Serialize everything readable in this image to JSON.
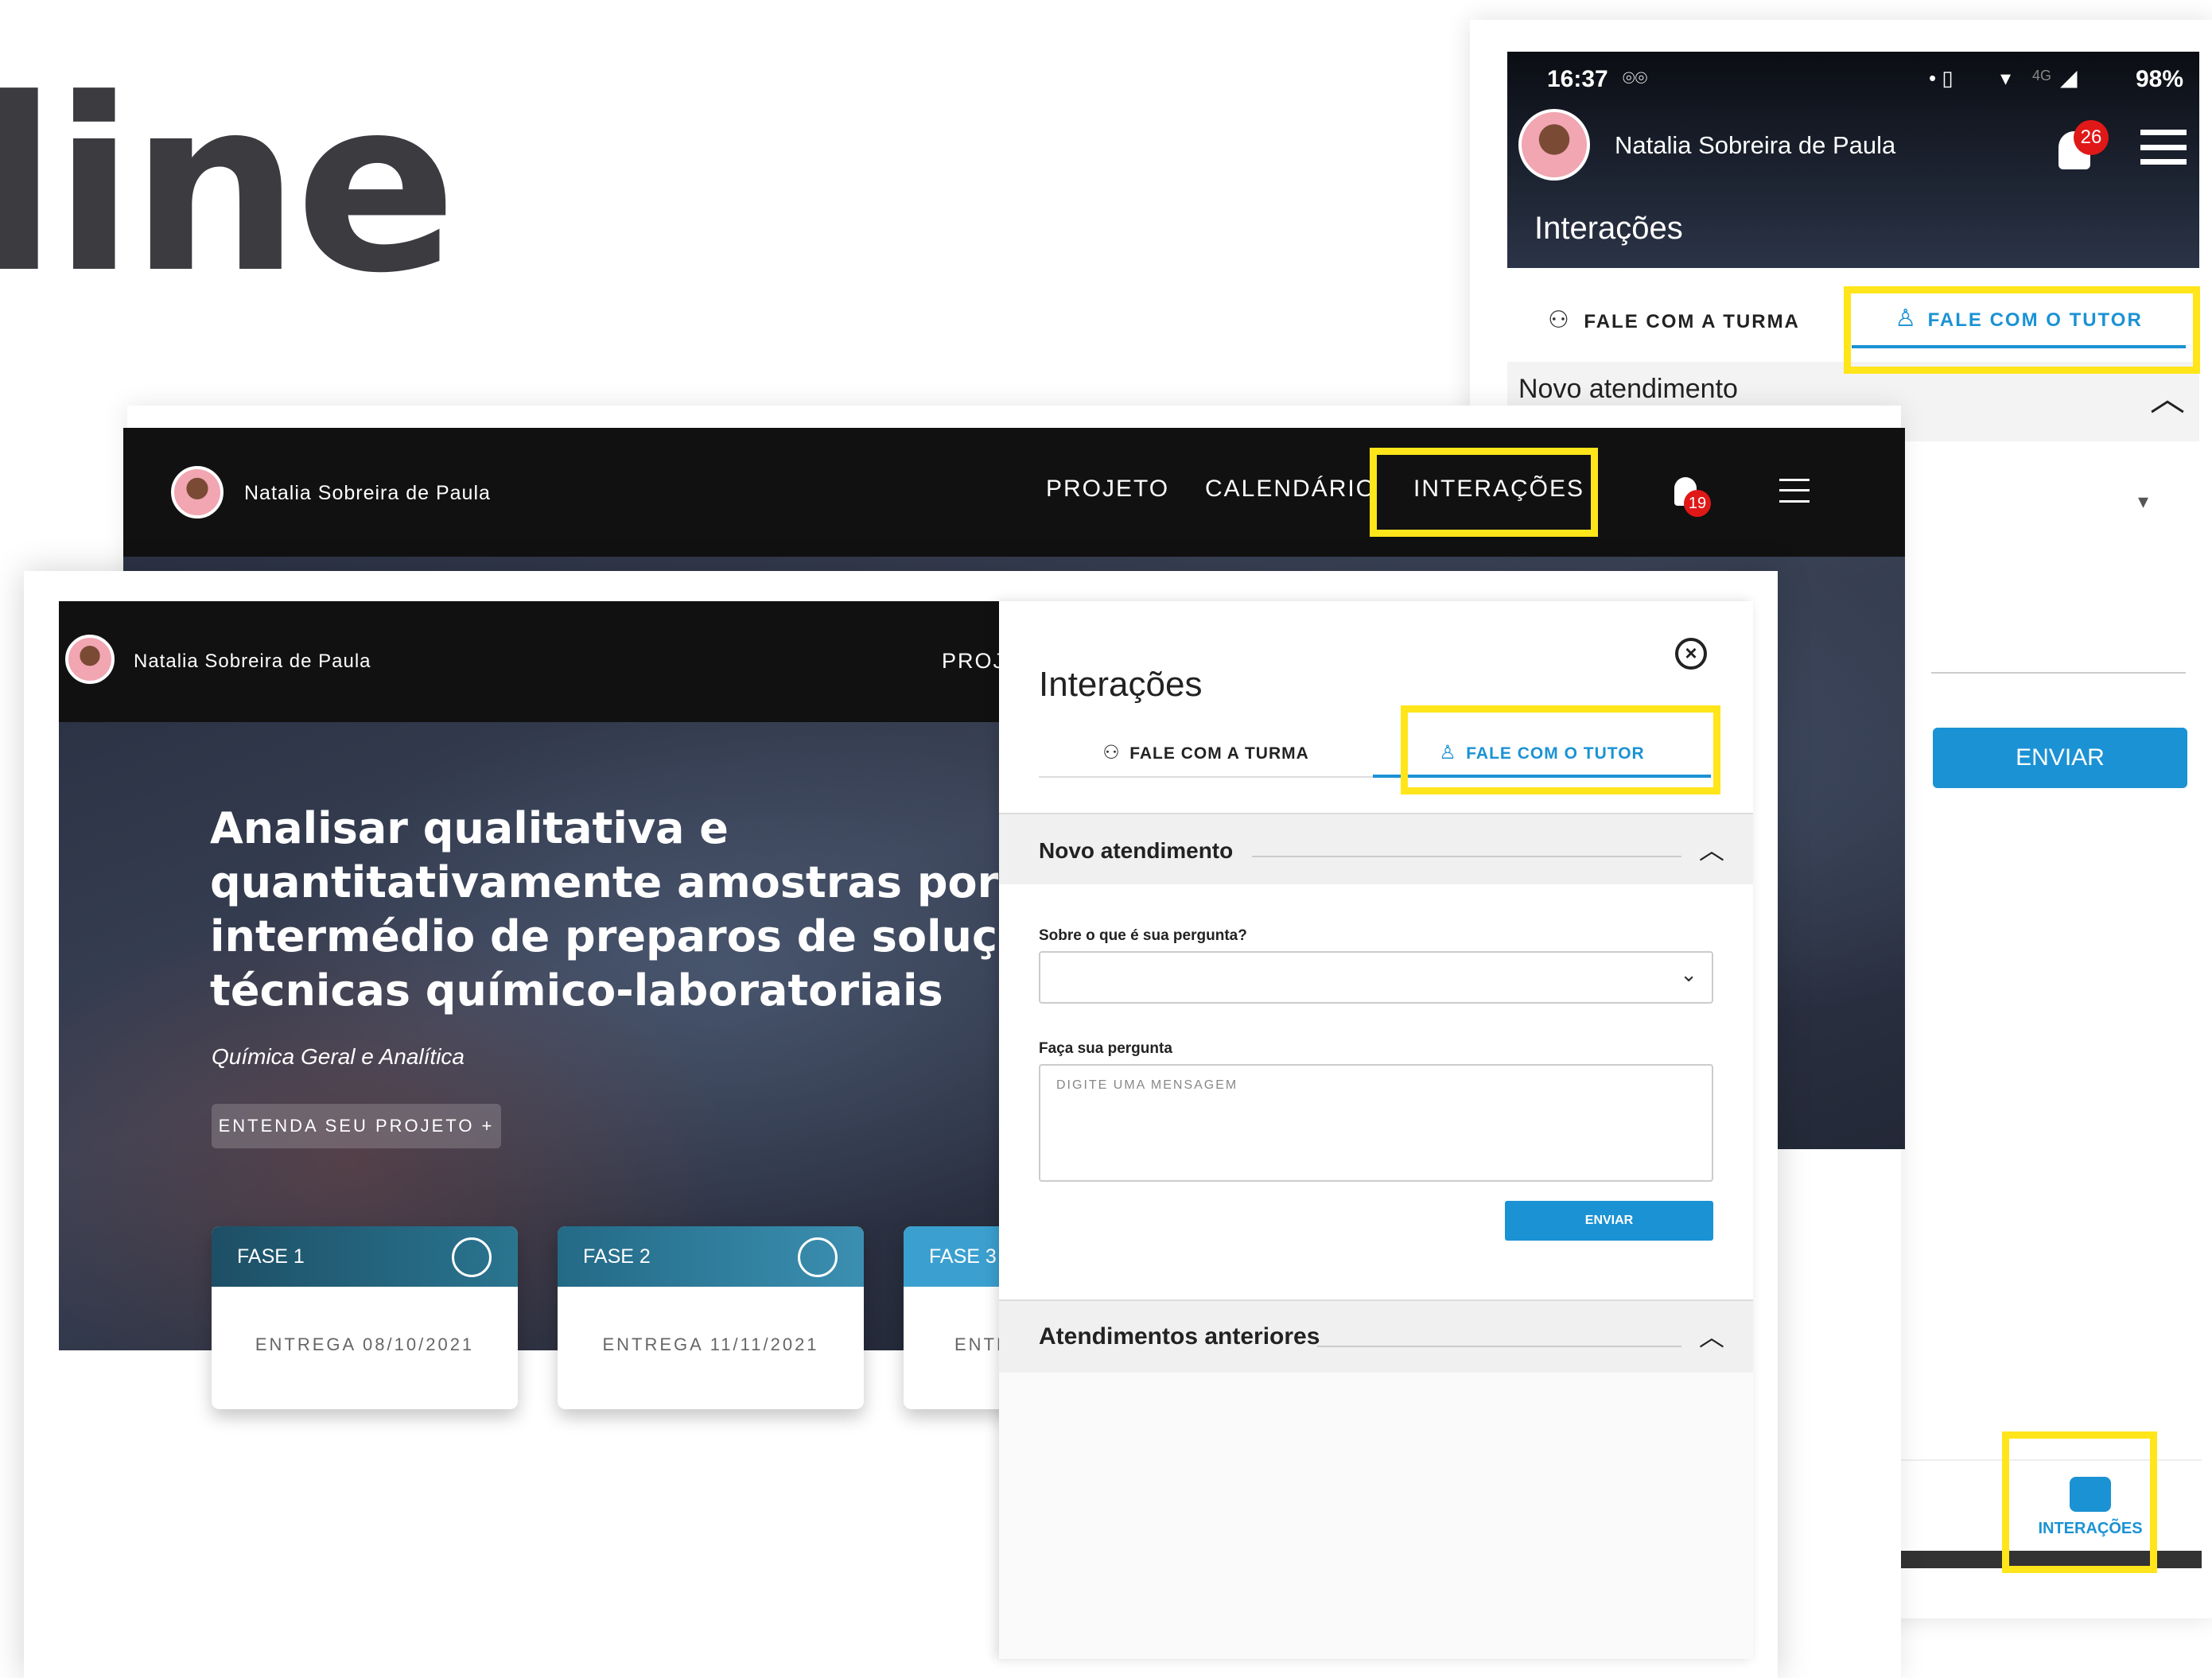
{
  "hero_word": "line",
  "user_name": "Natalia Sobreira de Paula",
  "mobile": {
    "time": "16:37",
    "battery": "98%",
    "network": "4G",
    "notif_count": "26",
    "title": "Interações",
    "tab_turma": "FALE COM A TURMA",
    "tab_tutor": "FALE COM O TUTOR",
    "novo": "Novo atendimento",
    "send": "ENVIAR",
    "bottom_nav_label": "INTERAÇÕES"
  },
  "desktop": {
    "nav": [
      "PROJETO",
      "CALENDÁRIO",
      "INTERAÇÕES"
    ],
    "notif_count": "19"
  },
  "front": {
    "nav_partial": "PROJ",
    "title_lines": [
      "Analisar qualitativa e",
      "quantitativamente amostras por",
      "intermédio de preparos de soluções",
      "técnicas químico-laboratoriais"
    ],
    "subtitle": "Química Geral e Analítica",
    "cta": "ENTENDA SEU PROJETO +",
    "phases": [
      {
        "name": "FASE 1",
        "date": "ENTREGA 08/10/2021"
      },
      {
        "name": "FASE 2",
        "date": "ENTREGA 11/11/2021"
      },
      {
        "name": "FASE 3",
        "date": "ENTR"
      }
    ],
    "panel": {
      "title": "Interações",
      "tab_turma": "FALE COM A TURMA",
      "tab_tutor": "FALE COM O TUTOR",
      "novo": "Novo atendimento",
      "q1": "Sobre o que é sua pergunta?",
      "q2": "Faça sua pergunta",
      "placeholder": "DIGITE UMA MENSAGEM",
      "send": "ENVIAR",
      "anteriores": "Atendimentos anteriores"
    }
  },
  "colors": {
    "accent_yellow": "#ffe51a",
    "blue": "#1b92d4",
    "teal": "#1d5c73",
    "nav_black": "#111111"
  }
}
